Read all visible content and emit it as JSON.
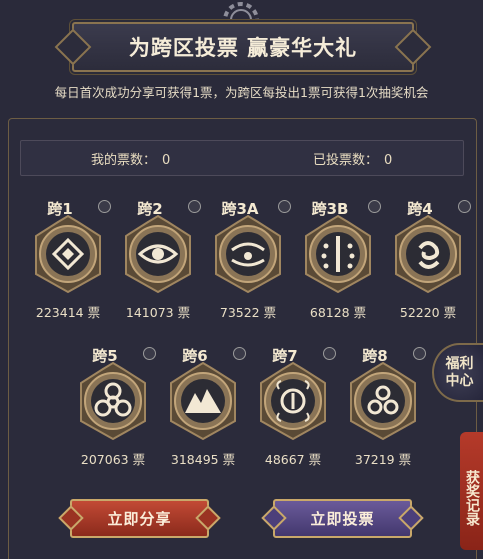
{
  "header": {
    "title": "为跨区投票 赢豪华大礼",
    "subtitle": "每日首次成功分享可获得1票，为跨区每投出1票可获得1次抽奖机会"
  },
  "stats": {
    "my_votes_label": "我的票数：",
    "my_votes_value": "0",
    "cast_votes_label": "已投票数：",
    "cast_votes_value": "0"
  },
  "regions": [
    {
      "name": "跨1",
      "votes": "223414 票",
      "icon": "rune-diamond-icon"
    },
    {
      "name": "跨2",
      "votes": "141073 票",
      "icon": "eye-icon"
    },
    {
      "name": "跨3A",
      "votes": "73522 票",
      "icon": "tentacle-sun-icon"
    },
    {
      "name": "跨3B",
      "votes": "68128 票",
      "icon": "sword-dots-icon"
    },
    {
      "name": "跨4",
      "votes": "52220 票",
      "icon": "swirl-icon"
    },
    {
      "name": "跨5",
      "votes": "207063 票",
      "icon": "biohazard-icon"
    },
    {
      "name": "跨6",
      "votes": "318495 票",
      "icon": "mountain-icon"
    },
    {
      "name": "跨7",
      "votes": "48667 票",
      "icon": "flame-ring-icon"
    },
    {
      "name": "跨8",
      "votes": "37219 票",
      "icon": "triple-circle-icon"
    }
  ],
  "side": {
    "welfare_label": "福利中心",
    "records_label": "获奖记录"
  },
  "buttons": {
    "share_label": "立即分享",
    "vote_label": "立即投票"
  },
  "colors": {
    "background": "#2a2a3a",
    "gold_border": "#8a7450",
    "share_button": "#b33f2c",
    "vote_button": "#5a4b88",
    "records_tab": "#a8321f"
  }
}
